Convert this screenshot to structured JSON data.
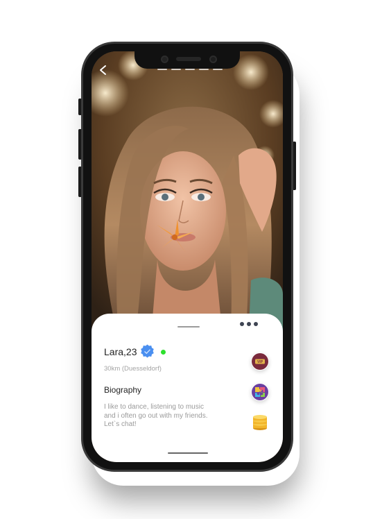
{
  "profile": {
    "name_age": "Lara,23",
    "distance_location": "30km (Duesseldorf)",
    "online": true
  },
  "biography": {
    "heading": "Biography",
    "text": "I like to dance, listening to music and i often go out with my friends. Let`s chat!"
  },
  "icons": {
    "back": "chevron-left-icon",
    "more": "more-dots-icon",
    "verified": "verified-badge-icon",
    "vip": "vip-ticket-icon",
    "puzzle": "puzzle-icon",
    "coins": "coins-icon"
  },
  "colors": {
    "online": "#2de02d",
    "verified": "#4a8ff0",
    "text_primary": "#222222",
    "text_secondary": "#9a9a9a"
  }
}
